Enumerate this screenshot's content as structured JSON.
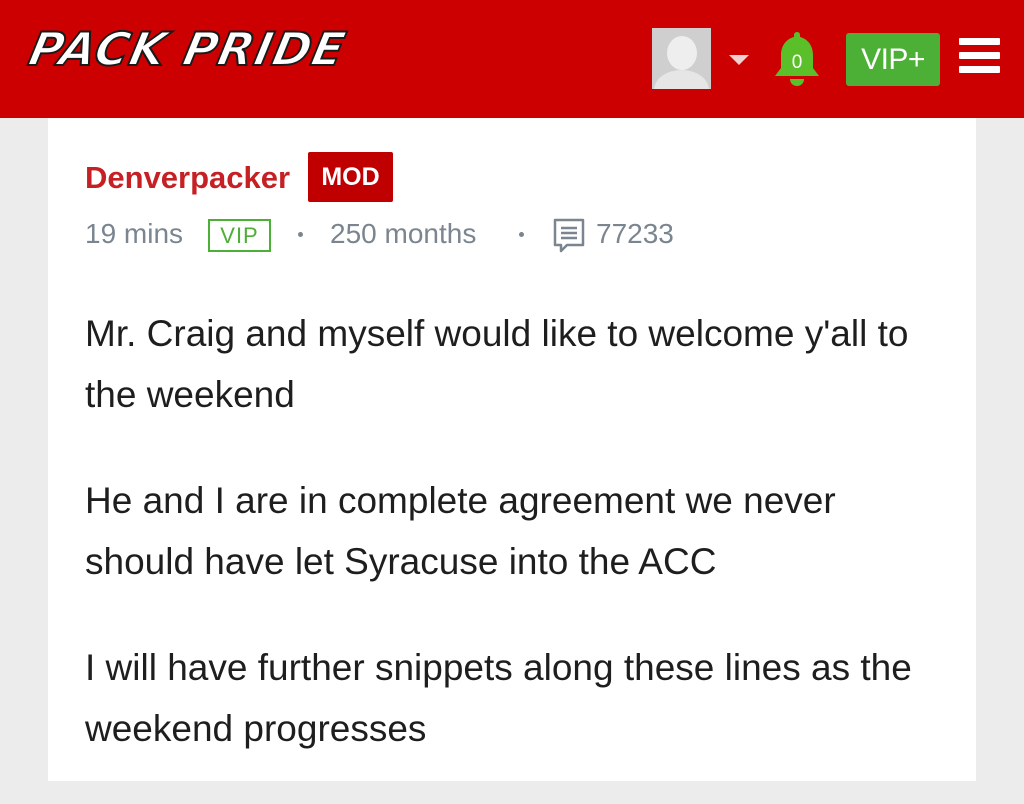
{
  "header": {
    "logo": "PACK PRIDE",
    "notification_count": "0",
    "vip_button_label": "VIP+",
    "colors": {
      "header_background": "#cc0000",
      "vip_green": "#4caf36",
      "bell_green": "#5bbf2a"
    },
    "icons": [
      "avatar",
      "chevron-down-icon",
      "bell-icon",
      "menu-icon"
    ]
  },
  "post": {
    "author": "Denverpacker",
    "role_badge": "MOD",
    "time_ago": "19 mins",
    "membership_tag": "VIP",
    "member_duration": "250 months",
    "post_count": "77233",
    "paragraphs": [
      "Mr. Craig and myself would like to welcome y'all to the weekend",
      "He and I are in complete agreement we never should have let Syracuse into the ACC",
      "I will have further snippets along these lines as the weekend progresses"
    ],
    "colors": {
      "author_red": "#c62025",
      "badge_red": "#c00000",
      "meta_gray": "#7a8590"
    }
  }
}
